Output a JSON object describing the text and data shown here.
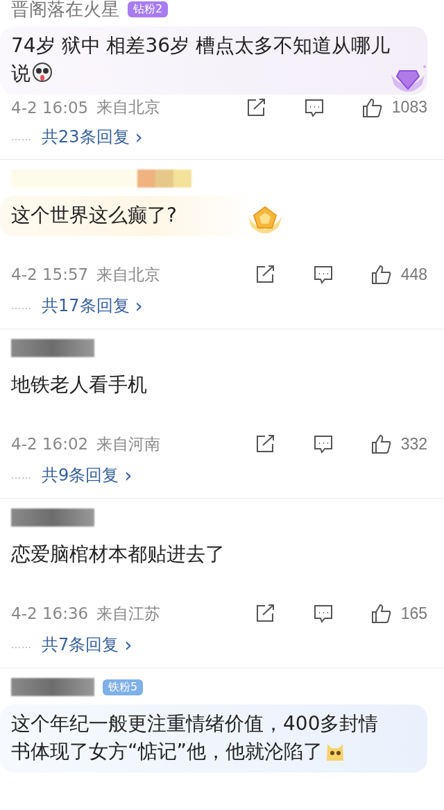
{
  "comments": [
    {
      "kind": "diamond",
      "name_hidden": false,
      "user": "晋阁落在火星",
      "badge": {
        "label": "钻粉2",
        "color": "#a77cf0"
      },
      "text": "74岁 狱中 相差36岁 槽点太多不知道从哪儿说",
      "emoji": true,
      "time": "4-2 16:05",
      "location": "来自北京",
      "likes": "1083",
      "replies": "共23条回复",
      "more": "……",
      "chevron": "›"
    },
    {
      "kind": "gold",
      "name_hidden": true,
      "text": "这个世界这么癫了?",
      "emoji": false,
      "time": "4-2 15:57",
      "location": "来自北京",
      "likes": "448",
      "replies": "共17条回复",
      "more": "……",
      "chevron": "›"
    },
    {
      "kind": "plain",
      "name_hidden": true,
      "text": "地铁老人看手机",
      "emoji": false,
      "time": "4-2 16:02",
      "location": "来自河南",
      "likes": "332",
      "replies": "共9条回复",
      "more": "……",
      "chevron": "›"
    },
    {
      "kind": "plain",
      "name_hidden": true,
      "text": "恋爱脑棺材本都贴进去了",
      "emoji": false,
      "time": "4-2 16:36",
      "location": "来自江苏",
      "likes": "165",
      "replies": "共7条回复",
      "more": "……",
      "chevron": "›"
    },
    {
      "kind": "iron",
      "name_hidden": true,
      "badge": {
        "label": "铁粉5",
        "color": "#7fb0e8"
      },
      "text": "这个年纪一般更注重情绪价值，400多封情书体现了女方“惦记”他，他就沦陷了",
      "emoji": true
    }
  ]
}
